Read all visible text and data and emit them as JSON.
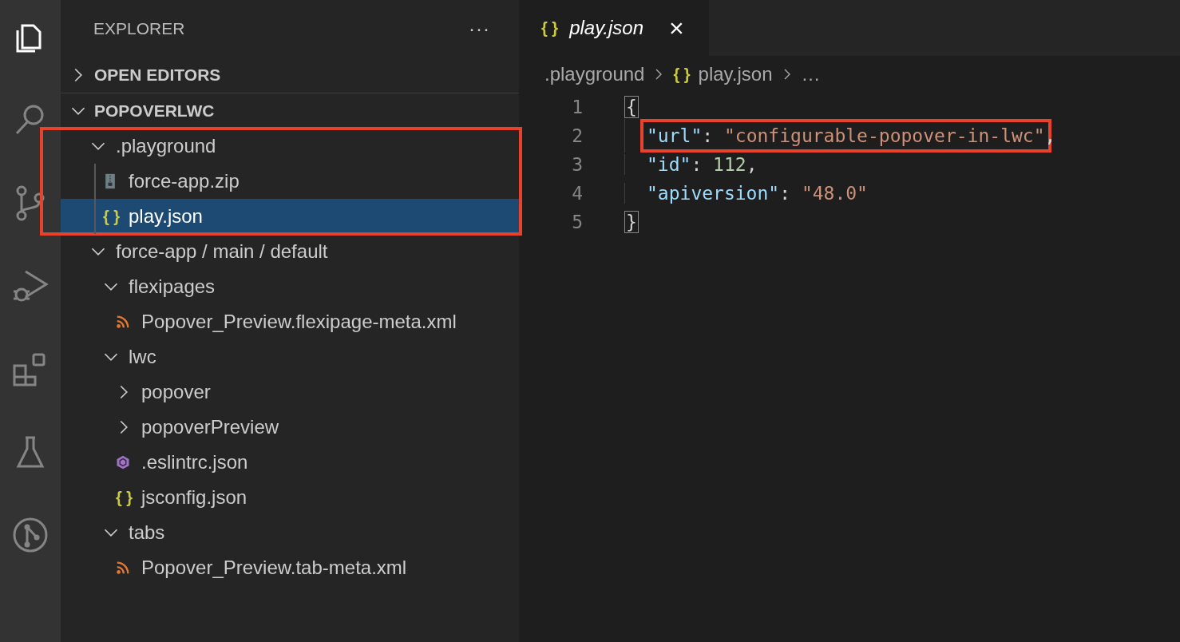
{
  "activity_bar": [
    {
      "kind": "files",
      "selected": true
    },
    {
      "kind": "search",
      "selected": false
    },
    {
      "kind": "source-control",
      "selected": false
    },
    {
      "kind": "debug",
      "selected": false
    },
    {
      "kind": "extensions",
      "selected": false
    },
    {
      "kind": "testing",
      "selected": false
    },
    {
      "kind": "git-graph",
      "selected": false
    }
  ],
  "sidebar": {
    "title": "EXPLORER",
    "more": "···",
    "sections": [
      {
        "label": "OPEN EDITORS",
        "expanded": false
      },
      {
        "label": "POPOVERLWC",
        "expanded": true
      }
    ],
    "tree": [
      {
        "label": ".playground",
        "kind": "folder",
        "expanded": true,
        "annotated": true,
        "children": [
          {
            "label": "force-app.zip",
            "kind": "zip",
            "selected": false
          },
          {
            "label": "play.json",
            "kind": "json",
            "icon": "{ }",
            "selected": true
          }
        ]
      },
      {
        "label": "force-app / main / default",
        "kind": "folder",
        "expanded": true,
        "annotated": false,
        "children": [
          {
            "label": "flexipages",
            "kind": "folder",
            "expanded": true,
            "annotated": false,
            "children": [
              {
                "label": "Popover_Preview.flexipage-meta.xml",
                "kind": "xml",
                "selected": false
              }
            ]
          },
          {
            "label": "lwc",
            "kind": "folder",
            "expanded": true,
            "annotated": false,
            "children": [
              {
                "label": "popover",
                "kind": "folder",
                "expanded": false,
                "annotated": false
              },
              {
                "label": "popoverPreview",
                "kind": "folder",
                "expanded": false,
                "annotated": false
              },
              {
                "label": ".eslintrc.json",
                "kind": "eslint",
                "selected": false
              },
              {
                "label": "jsconfig.json",
                "kind": "json",
                "icon": "{ }",
                "selected": false
              }
            ]
          },
          {
            "label": "tabs",
            "kind": "folder",
            "expanded": true,
            "annotated": false,
            "children": [
              {
                "label": "Popover_Preview.tab-meta.xml",
                "kind": "xml",
                "selected": false
              }
            ]
          }
        ]
      }
    ]
  },
  "editor": {
    "tabs": [
      {
        "label": "play.json",
        "icon": "{ }",
        "close": "×",
        "selected": true
      }
    ],
    "breadcrumb": [
      ".playground",
      {
        "icon": "{ }",
        "label": "play.json"
      },
      "…"
    ],
    "lines": [
      {
        "number": "1",
        "annotated": false,
        "tokens": [
          {
            "kind": "bracket",
            "text": "{"
          }
        ]
      },
      {
        "number": "2",
        "annotated": true,
        "tokens": [
          {
            "kind": "key",
            "text": "\"url\""
          },
          {
            "kind": "punct",
            "text": ": "
          },
          {
            "kind": "string",
            "text": "\"configurable-popover-in-lwc\""
          },
          {
            "kind": "punct",
            "text": ","
          }
        ]
      },
      {
        "number": "3",
        "annotated": false,
        "tokens": [
          {
            "kind": "key",
            "text": "\"id\""
          },
          {
            "kind": "punct",
            "text": ": "
          },
          {
            "kind": "number",
            "text": "112"
          },
          {
            "kind": "punct",
            "text": ","
          }
        ]
      },
      {
        "number": "4",
        "annotated": false,
        "tokens": [
          {
            "kind": "key",
            "text": "\"apiversion\""
          },
          {
            "kind": "punct",
            "text": ": "
          },
          {
            "kind": "string",
            "text": "\"48.0\""
          }
        ]
      },
      {
        "number": "5",
        "annotated": false,
        "tokens": [
          {
            "kind": "bracket",
            "text": "}"
          }
        ]
      }
    ]
  }
}
